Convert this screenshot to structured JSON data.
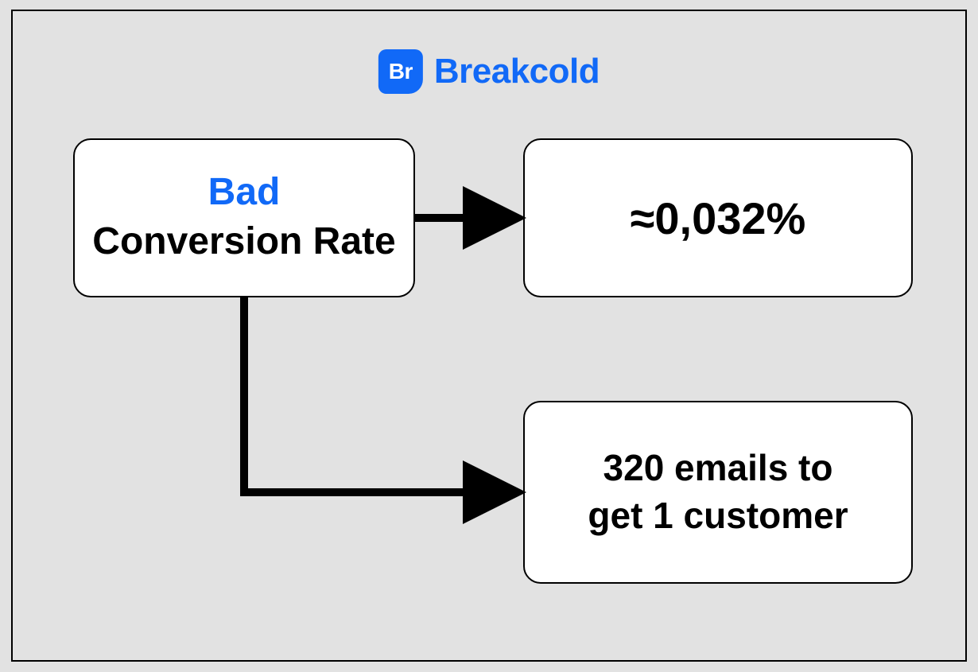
{
  "brand": {
    "badge": "Br",
    "name": "Breakcold",
    "color": "#1169f7"
  },
  "boxes": {
    "left": {
      "line1": "Bad",
      "line2": "Conversion Rate"
    },
    "right_top": {
      "value": "≈0,032%"
    },
    "right_bottom": {
      "line1": "320 emails to",
      "line2": "get 1 customer"
    }
  }
}
